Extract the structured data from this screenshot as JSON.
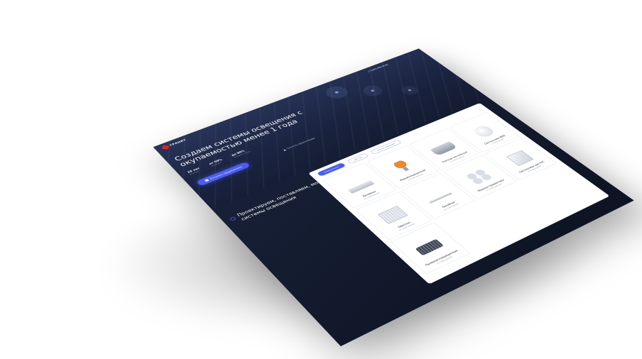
{
  "header": {
    "logo_text": "ГРАНИТ",
    "phone": "+7 (000) 000-00-00"
  },
  "hero": {
    "title": "Создаем системы освещения с окупаемостью менее 1 года",
    "stats": [
      {
        "value": "10 лет",
        "caption": "на рынке"
      },
      {
        "value": "от 50%",
        "caption": "экономия"
      },
      {
        "value": "до 80%",
        "caption": "снижение затрат"
      }
    ],
    "cta_label": "Получить предложение",
    "link_label": "Скачать презентацию"
  },
  "section": {
    "title": "Проектируем, поставляем, монтируем системы освещения"
  },
  "catalog": {
    "tabs": [
      {
        "label": "Промышленное"
      },
      {
        "label": "Офисное"
      },
      {
        "label": "Уличное освещение"
      }
    ],
    "products": [
      {
        "name": "Линейные",
        "price": "от 1 990 рублей",
        "icon": "linear-fixture-icon",
        "shape": "shape-linear"
      },
      {
        "name": "Взрывозащищенные",
        "price": "от 5 990 рублей",
        "icon": "explosion-proof-fixture-icon",
        "shape": "shape-orange"
      },
      {
        "name": "Уличные консольные",
        "price": "от 3 990 рублей",
        "icon": "street-fixture-icon",
        "shape": "shape-street"
      },
      {
        "name": "Светильники ЖКХ",
        "price": "от 690 рублей",
        "icon": "round-fixture-icon",
        "shape": "shape-round"
      },
      {
        "name": "Офисные",
        "price": "от 1 490 рублей",
        "icon": "office-panel-icon",
        "shape": "shape-panel"
      },
      {
        "name": "Линейные",
        "price": "от 1 190 рублей",
        "icon": "tube-fixture-icon",
        "shape": "shape-tube"
      },
      {
        "name": "Мощные прожекторы",
        "price": "от 12 990 рублей",
        "icon": "multi-head-fixture-icon",
        "shape": "shape-multi"
      },
      {
        "name": "Светильники для АЗС",
        "price": "от 4 990 рублей",
        "icon": "square-fixture-icon",
        "shape": "shape-square"
      },
      {
        "name": "Пылевлагозащищенные",
        "price": "от 2 990 рублей",
        "icon": "ip-fixture-icon",
        "shape": "shape-ip"
      }
    ]
  }
}
